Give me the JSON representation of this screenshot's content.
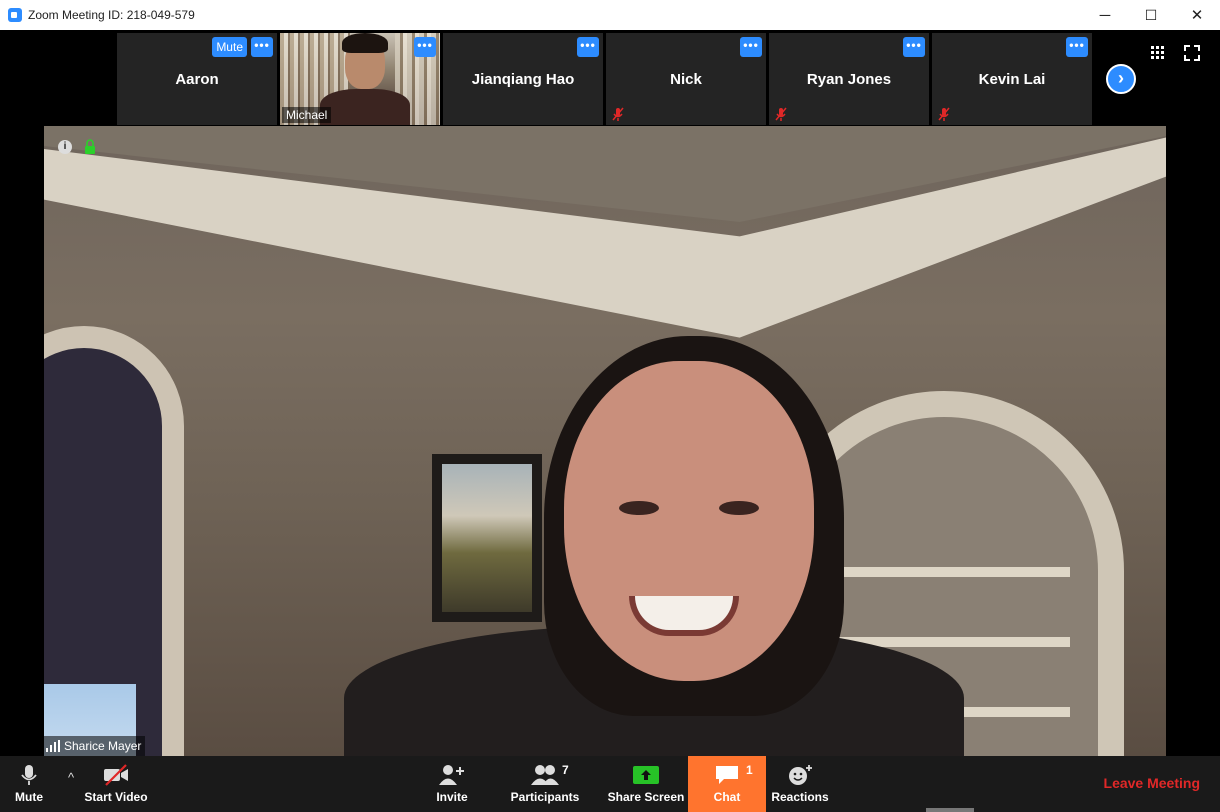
{
  "window": {
    "title": "Zoom Meeting ID: 218-049-579",
    "minimize": "─",
    "maximize": "☐",
    "close": "✕"
  },
  "filmstrip": {
    "tiles": [
      {
        "name": "Aaron",
        "has_mute_button": true,
        "mute_label": "Mute",
        "more": "•••",
        "muted": false
      },
      {
        "name": "Michael",
        "video": true,
        "more": "•••"
      },
      {
        "name": "Jianqiang Hao",
        "more": "•••",
        "muted": false
      },
      {
        "name": "Nick",
        "more": "•••",
        "muted": true
      },
      {
        "name": "Ryan Jones",
        "more": "•••",
        "muted": true
      },
      {
        "name": "Kevin Lai",
        "more": "•••",
        "muted": true
      }
    ],
    "next_arrow": "›"
  },
  "main_video": {
    "speaker_name": "Sharice Mayer",
    "info_glyph": "i"
  },
  "toolbar": {
    "mute_label": "Mute",
    "caret": "^",
    "start_video_label": "Start Video",
    "invite_label": "Invite",
    "participants_label": "Participants",
    "participants_count": "7",
    "share_screen_label": "Share Screen",
    "chat_label": "Chat",
    "chat_badge": "1",
    "reactions_label": "Reactions",
    "leave_label": "Leave Meeting"
  },
  "colors": {
    "accent": "#2d8cff",
    "chat": "#ff742e",
    "leave": "#e02828",
    "share_green": "#27c227"
  }
}
